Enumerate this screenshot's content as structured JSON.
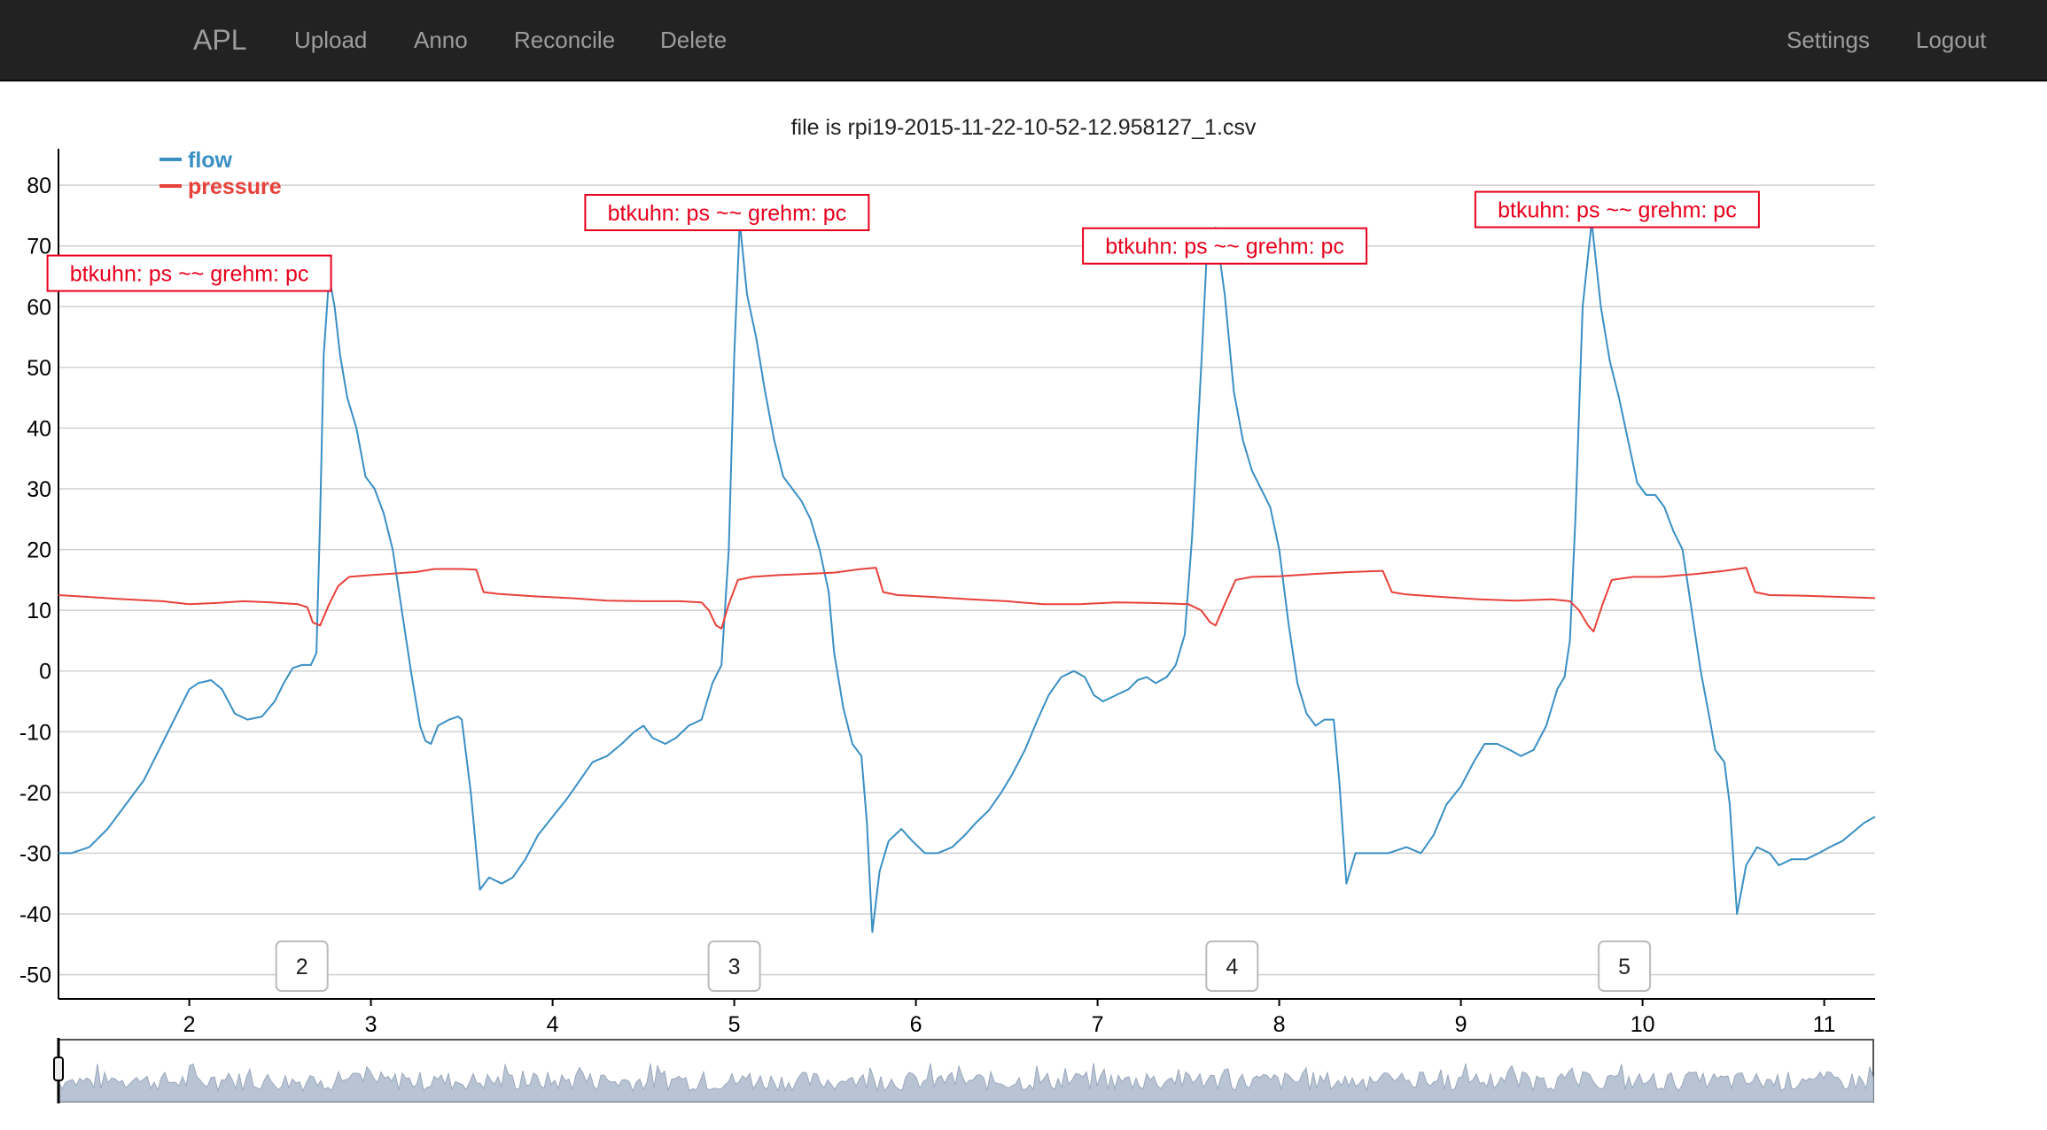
{
  "nav": {
    "brand": "APL",
    "items": [
      "Upload",
      "Anno",
      "Reconcile",
      "Delete"
    ],
    "right_items": [
      "Settings",
      "Logout"
    ]
  },
  "page": {
    "file_title": "file is rpi19-2015-11-22-10-52-12.958127_1.csv"
  },
  "colors": {
    "navbar": "#222222",
    "nav_text": "#9d9d9d",
    "flow": "#3a8fc4",
    "pressure": "#e8413a",
    "annotation": "#e8001c",
    "grid": "#d0d0d0",
    "overview_fill": "#b8c4d4"
  },
  "chart_data": {
    "type": "line",
    "y_ticks": [
      80,
      70,
      60,
      50,
      40,
      30,
      20,
      10,
      0,
      -10,
      -20,
      -30,
      -40,
      -50
    ],
    "x_ticks": [
      2,
      3,
      4,
      5,
      6,
      7,
      8,
      9,
      10,
      11
    ],
    "xlim": [
      1.28,
      11.28
    ],
    "ylim": [
      -54,
      86
    ],
    "grid": true,
    "legend_position": "top-left",
    "series": [
      {
        "name": "flow",
        "color": "#3a8fc4",
        "points": [
          [
            1.28,
            -30
          ],
          [
            1.35,
            -30
          ],
          [
            1.45,
            -29
          ],
          [
            1.55,
            -26
          ],
          [
            1.65,
            -22
          ],
          [
            1.75,
            -18
          ],
          [
            1.85,
            -12
          ],
          [
            1.95,
            -6
          ],
          [
            2.0,
            -3
          ],
          [
            2.05,
            -2
          ],
          [
            2.12,
            -1.5
          ],
          [
            2.18,
            -3
          ],
          [
            2.25,
            -7
          ],
          [
            2.32,
            -8
          ],
          [
            2.4,
            -7.5
          ],
          [
            2.47,
            -5
          ],
          [
            2.52,
            -2
          ],
          [
            2.57,
            0.5
          ],
          [
            2.62,
            1
          ],
          [
            2.67,
            1
          ],
          [
            2.7,
            3
          ],
          [
            2.72,
            25
          ],
          [
            2.74,
            52
          ],
          [
            2.77,
            65
          ],
          [
            2.8,
            60
          ],
          [
            2.83,
            52
          ],
          [
            2.87,
            45
          ],
          [
            2.92,
            40
          ],
          [
            2.97,
            32
          ],
          [
            3.02,
            30
          ],
          [
            3.07,
            26
          ],
          [
            3.12,
            20
          ],
          [
            3.17,
            10
          ],
          [
            3.22,
            0
          ],
          [
            3.27,
            -9
          ],
          [
            3.3,
            -11.5
          ],
          [
            3.33,
            -12
          ],
          [
            3.37,
            -9
          ],
          [
            3.43,
            -8
          ],
          [
            3.48,
            -7.5
          ],
          [
            3.5,
            -8
          ],
          [
            3.55,
            -20
          ],
          [
            3.6,
            -36
          ],
          [
            3.65,
            -34
          ],
          [
            3.72,
            -35
          ],
          [
            3.78,
            -34
          ],
          [
            3.85,
            -31
          ],
          [
            3.92,
            -27
          ],
          [
            4.0,
            -24
          ],
          [
            4.08,
            -21
          ],
          [
            4.15,
            -18
          ],
          [
            4.22,
            -15
          ],
          [
            4.3,
            -14
          ],
          [
            4.38,
            -12
          ],
          [
            4.45,
            -10
          ],
          [
            4.5,
            -9
          ],
          [
            4.55,
            -11
          ],
          [
            4.62,
            -12
          ],
          [
            4.68,
            -11
          ],
          [
            4.75,
            -9
          ],
          [
            4.82,
            -8
          ],
          [
            4.88,
            -2
          ],
          [
            4.93,
            1
          ],
          [
            4.97,
            20
          ],
          [
            5.0,
            52
          ],
          [
            5.03,
            74
          ],
          [
            5.07,
            62
          ],
          [
            5.12,
            55
          ],
          [
            5.17,
            46
          ],
          [
            5.22,
            38
          ],
          [
            5.27,
            32
          ],
          [
            5.32,
            30
          ],
          [
            5.37,
            28
          ],
          [
            5.42,
            25
          ],
          [
            5.47,
            20
          ],
          [
            5.52,
            13
          ],
          [
            5.55,
            3
          ],
          [
            5.6,
            -6
          ],
          [
            5.65,
            -12
          ],
          [
            5.7,
            -14
          ],
          [
            5.73,
            -25
          ],
          [
            5.76,
            -43
          ],
          [
            5.8,
            -33
          ],
          [
            5.85,
            -28
          ],
          [
            5.92,
            -26
          ],
          [
            5.98,
            -28
          ],
          [
            6.05,
            -30
          ],
          [
            6.12,
            -30
          ],
          [
            6.2,
            -29
          ],
          [
            6.27,
            -27
          ],
          [
            6.33,
            -25
          ],
          [
            6.4,
            -23
          ],
          [
            6.47,
            -20
          ],
          [
            6.53,
            -17
          ],
          [
            6.6,
            -13
          ],
          [
            6.67,
            -8
          ],
          [
            6.73,
            -4
          ],
          [
            6.8,
            -1
          ],
          [
            6.87,
            0
          ],
          [
            6.93,
            -1
          ],
          [
            6.98,
            -4
          ],
          [
            7.03,
            -5
          ],
          [
            7.1,
            -4
          ],
          [
            7.17,
            -3
          ],
          [
            7.22,
            -1.5
          ],
          [
            7.27,
            -1
          ],
          [
            7.32,
            -2
          ],
          [
            7.38,
            -1
          ],
          [
            7.43,
            1
          ],
          [
            7.48,
            6
          ],
          [
            7.52,
            22
          ],
          [
            7.57,
            50
          ],
          [
            7.6,
            68
          ],
          [
            7.65,
            73
          ],
          [
            7.7,
            62
          ],
          [
            7.75,
            46
          ],
          [
            7.8,
            38
          ],
          [
            7.85,
            33
          ],
          [
            7.9,
            30
          ],
          [
            7.95,
            27
          ],
          [
            8.0,
            20
          ],
          [
            8.05,
            8
          ],
          [
            8.1,
            -2
          ],
          [
            8.15,
            -7
          ],
          [
            8.2,
            -9
          ],
          [
            8.25,
            -8
          ],
          [
            8.3,
            -8
          ],
          [
            8.33,
            -18
          ],
          [
            8.37,
            -35
          ],
          [
            8.42,
            -30
          ],
          [
            8.5,
            -30
          ],
          [
            8.6,
            -30
          ],
          [
            8.7,
            -29
          ],
          [
            8.78,
            -30
          ],
          [
            8.85,
            -27
          ],
          [
            8.92,
            -22
          ],
          [
            9.0,
            -19
          ],
          [
            9.07,
            -15
          ],
          [
            9.13,
            -12
          ],
          [
            9.2,
            -12
          ],
          [
            9.27,
            -13
          ],
          [
            9.33,
            -14
          ],
          [
            9.4,
            -13
          ],
          [
            9.47,
            -9
          ],
          [
            9.53,
            -3
          ],
          [
            9.57,
            -1
          ],
          [
            9.6,
            5
          ],
          [
            9.63,
            25
          ],
          [
            9.67,
            60
          ],
          [
            9.72,
            74
          ],
          [
            9.77,
            60
          ],
          [
            9.82,
            51
          ],
          [
            9.87,
            45
          ],
          [
            9.92,
            38
          ],
          [
            9.97,
            31
          ],
          [
            10.02,
            29
          ],
          [
            10.07,
            29
          ],
          [
            10.12,
            27
          ],
          [
            10.17,
            23
          ],
          [
            10.22,
            20
          ],
          [
            10.27,
            10
          ],
          [
            10.32,
            0
          ],
          [
            10.37,
            -8
          ],
          [
            10.4,
            -13
          ],
          [
            10.45,
            -15
          ],
          [
            10.48,
            -22
          ],
          [
            10.52,
            -40
          ],
          [
            10.57,
            -32
          ],
          [
            10.63,
            -29
          ],
          [
            10.7,
            -30
          ],
          [
            10.75,
            -32
          ],
          [
            10.82,
            -31
          ],
          [
            10.9,
            -31
          ],
          [
            10.97,
            -30
          ],
          [
            11.03,
            -29
          ],
          [
            11.1,
            -28
          ],
          [
            11.18,
            -26
          ],
          [
            11.22,
            -25
          ],
          [
            11.28,
            -24
          ]
        ]
      },
      {
        "name": "pressure",
        "color": "#e8413a",
        "points": [
          [
            1.28,
            12.5
          ],
          [
            1.45,
            12.2
          ],
          [
            1.65,
            11.8
          ],
          [
            1.85,
            11.5
          ],
          [
            2.0,
            11
          ],
          [
            2.15,
            11.2
          ],
          [
            2.3,
            11.5
          ],
          [
            2.45,
            11.3
          ],
          [
            2.6,
            11
          ],
          [
            2.65,
            10.5
          ],
          [
            2.68,
            8
          ],
          [
            2.72,
            7.5
          ],
          [
            2.77,
            11
          ],
          [
            2.82,
            14
          ],
          [
            2.88,
            15.5
          ],
          [
            3.0,
            15.8
          ],
          [
            3.1,
            16
          ],
          [
            3.25,
            16.3
          ],
          [
            3.35,
            16.8
          ],
          [
            3.5,
            16.8
          ],
          [
            3.58,
            16.7
          ],
          [
            3.62,
            13
          ],
          [
            3.7,
            12.7
          ],
          [
            3.9,
            12.3
          ],
          [
            4.1,
            12
          ],
          [
            4.3,
            11.6
          ],
          [
            4.5,
            11.5
          ],
          [
            4.7,
            11.5
          ],
          [
            4.82,
            11.3
          ],
          [
            4.86,
            10
          ],
          [
            4.9,
            7.5
          ],
          [
            4.93,
            7
          ],
          [
            4.97,
            11
          ],
          [
            5.02,
            15
          ],
          [
            5.1,
            15.5
          ],
          [
            5.25,
            15.8
          ],
          [
            5.4,
            16
          ],
          [
            5.55,
            16.2
          ],
          [
            5.7,
            16.8
          ],
          [
            5.78,
            17
          ],
          [
            5.82,
            13
          ],
          [
            5.9,
            12.5
          ],
          [
            6.1,
            12.2
          ],
          [
            6.3,
            11.8
          ],
          [
            6.5,
            11.5
          ],
          [
            6.7,
            11
          ],
          [
            6.9,
            11
          ],
          [
            7.1,
            11.3
          ],
          [
            7.3,
            11.2
          ],
          [
            7.5,
            11
          ],
          [
            7.57,
            10
          ],
          [
            7.62,
            8
          ],
          [
            7.65,
            7.5
          ],
          [
            7.7,
            11
          ],
          [
            7.76,
            15
          ],
          [
            7.85,
            15.5
          ],
          [
            8.0,
            15.6
          ],
          [
            8.2,
            16
          ],
          [
            8.4,
            16.3
          ],
          [
            8.57,
            16.5
          ],
          [
            8.62,
            13
          ],
          [
            8.7,
            12.6
          ],
          [
            8.9,
            12.2
          ],
          [
            9.1,
            11.8
          ],
          [
            9.3,
            11.6
          ],
          [
            9.5,
            11.8
          ],
          [
            9.6,
            11.5
          ],
          [
            9.65,
            10
          ],
          [
            9.7,
            7.5
          ],
          [
            9.73,
            6.5
          ],
          [
            9.78,
            11
          ],
          [
            9.83,
            15
          ],
          [
            9.95,
            15.5
          ],
          [
            10.1,
            15.5
          ],
          [
            10.3,
            16
          ],
          [
            10.45,
            16.5
          ],
          [
            10.57,
            17
          ],
          [
            10.62,
            13
          ],
          [
            10.7,
            12.5
          ],
          [
            10.9,
            12.4
          ],
          [
            11.1,
            12.2
          ],
          [
            11.28,
            12
          ]
        ]
      }
    ],
    "annotations": [
      {
        "text": "btkuhn: ps ~~ grehm: pc",
        "x": 2.0,
        "y": 65.5
      },
      {
        "text": "btkuhn: ps ~~ grehm: pc",
        "x": 4.96,
        "y": 75.5
      },
      {
        "text": "btkuhn: ps ~~ grehm: pc",
        "x": 7.7,
        "y": 70
      },
      {
        "text": "btkuhn: ps ~~ grehm: pc",
        "x": 9.86,
        "y": 76
      }
    ],
    "breath_markers": [
      {
        "label": "2",
        "x": 2.62
      },
      {
        "label": "3",
        "x": 5.0
      },
      {
        "label": "4",
        "x": 7.74
      },
      {
        "label": "5",
        "x": 9.9
      }
    ]
  }
}
